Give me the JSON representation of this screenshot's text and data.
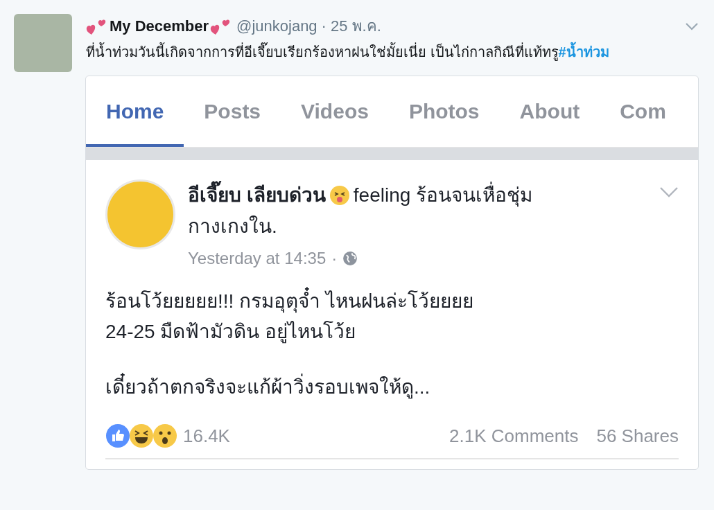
{
  "tweet": {
    "display_name": "My December",
    "handle": "@junkojang",
    "separator": "·",
    "time": "25 พ.ค.",
    "text": "ที่น้ำท่วมวันนี้เกิดจากการที่อีเจี๊ยบเรียกร้องหาฝนใช่มั้ยเนี่ย เป็นไก่กาลกิณีที่แท้ทรู",
    "hashtag": "#น้ำท่วม"
  },
  "embed": {
    "tabs": [
      {
        "label": "Home",
        "selected": true
      },
      {
        "label": "Posts",
        "selected": false
      },
      {
        "label": "Videos",
        "selected": false
      },
      {
        "label": "Photos",
        "selected": false
      },
      {
        "label": "About",
        "selected": false
      },
      {
        "label": "Com",
        "selected": false
      }
    ],
    "post": {
      "author": "อีเจี๊ยบ เลียบด่วน",
      "feeling_lines": [
        "feeling ร้อนจนเหื่อชุ่ม",
        "กางเกงใน."
      ],
      "timestamp": "Yesterday at 14:35",
      "separator": "·",
      "paragraphs": [
        "ร้อนโว้ยยยยย!!! กรมอุตุจ๋ำ ไหนฝนล่ะโว้ยยยย\n24-25 มืดฟ้ามัวดิน อยู่ไหนโว้ย",
        "เดี๋ยวถ้าตกจริงจะแก้ผ้าวิ่งรอบเพจให้ดู..."
      ],
      "reactions": "16.4K",
      "comments": "2.1K Comments",
      "shares": "56 Shares"
    }
  }
}
